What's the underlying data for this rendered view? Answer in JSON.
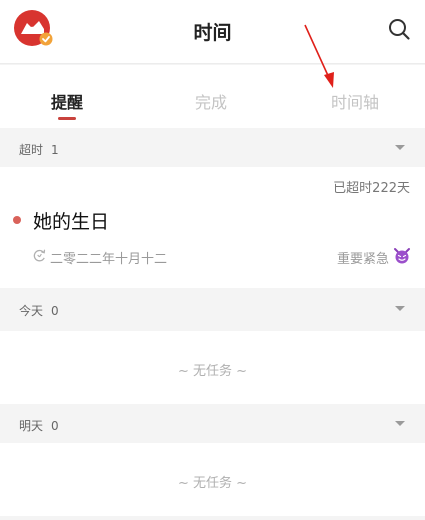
{
  "header": {
    "title": "时间",
    "avatar_icon": "cloud-logo-icon",
    "search_icon": "search-icon"
  },
  "tabs": [
    {
      "label": "提醒",
      "active": true
    },
    {
      "label": "完成",
      "active": false
    },
    {
      "label": "时间轴",
      "active": false
    }
  ],
  "sections": {
    "overdue": {
      "label": "超时",
      "count": "1"
    },
    "today": {
      "label": "今天",
      "count": "0"
    },
    "tomorrow": {
      "label": "明天",
      "count": "0"
    }
  },
  "task": {
    "overdue_text": "已超时222天",
    "title": "她的生日",
    "date": "二零二二年十月十二",
    "priority": "重要紧急",
    "priority_icon": "devil-face-icon",
    "repeat_icon": "repeat-icon",
    "dot_color": "#d9625a"
  },
  "empty": {
    "today_text": "~ 无任务 ~",
    "tomorrow_text": "~ 无任务 ~"
  },
  "colors": {
    "accent": "#c9423d",
    "annotation_arrow": "#e0201a"
  }
}
